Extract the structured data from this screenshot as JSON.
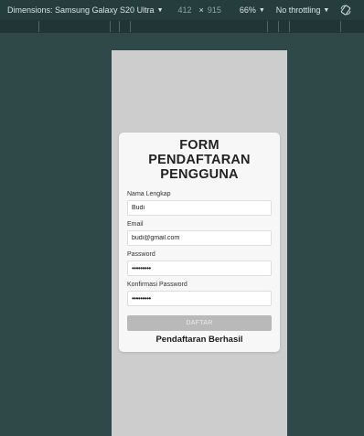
{
  "devtools": {
    "dimensions_label": "Dimensions: Samsung Galaxy S20 Ultra",
    "width_value": "412",
    "times_sign": "×",
    "height_value": "915",
    "zoom_label": "66%",
    "throttling_label": "No throttling",
    "caret_icon": "chevron-down-icon",
    "rotate_icon": "rotate-icon"
  },
  "form": {
    "title": "FORM PENDAFTARAN PENGGUNA",
    "fields": [
      {
        "label": "Nama Lengkap",
        "value": "Budi"
      },
      {
        "label": "Email",
        "value": "budi@gmail.com"
      },
      {
        "label": "Password",
        "value": "•••••••••"
      },
      {
        "label": "Konfirmasi Password",
        "value": "•••••••••"
      }
    ],
    "submit_label": "DAFTAR",
    "success_message": "Pendaftaran Berhasil"
  },
  "colors": {
    "devtools_background": "#2f4848",
    "viewport_background": "#cdcdcd",
    "card_background": "#f7f7f7",
    "button_background": "#b9b9b9"
  }
}
